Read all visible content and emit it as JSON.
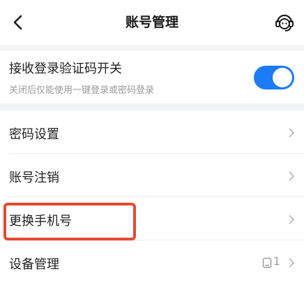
{
  "header": {
    "title": "账号管理",
    "back_icon": "chevron-left-icon",
    "support_icon": "customer-service-icon"
  },
  "login_code_toggle": {
    "title": "接收登录验证码开关",
    "subtitle": "关闭后仅能使用一键登录或密码登录",
    "enabled": true,
    "accent": "#1a7bf4"
  },
  "menu": {
    "items": [
      {
        "label": "密码设置"
      },
      {
        "label": "账号注销"
      },
      {
        "label": "更换手机号"
      },
      {
        "label": "设备管理",
        "count": "1",
        "icon": "device-icon"
      }
    ]
  },
  "highlight_color": "#e54a2e"
}
